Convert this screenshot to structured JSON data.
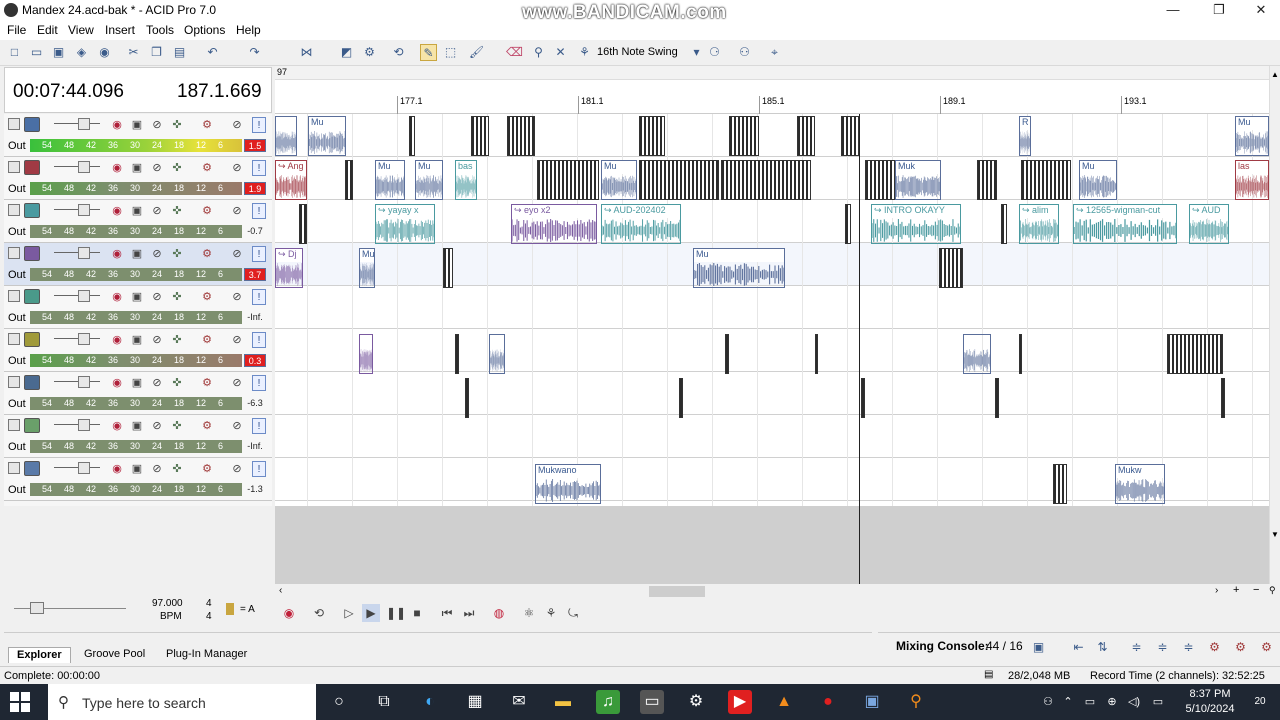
{
  "window": {
    "title": "Mandex 24.acd-bak * - ACID Pro 7.0",
    "watermark": "www.BANDICAM.com",
    "min": "—",
    "max": "❐",
    "close": "✕"
  },
  "menu": [
    "File",
    "Edit",
    "View",
    "Insert",
    "Tools",
    "Options",
    "Help"
  ],
  "toolbar": {
    "swing": "16th Note Swing"
  },
  "transport_display": {
    "time": "00:07:44.096",
    "beat": "187.1.669"
  },
  "meter_ticks": [
    "54",
    "48",
    "42",
    "36",
    "30",
    "24",
    "18",
    "12",
    "6"
  ],
  "tracks": [
    {
      "color": "#4a6fa5",
      "out": "Out",
      "level": "1.5",
      "clip": true,
      "selected": false
    },
    {
      "color": "#a03a44",
      "out": "Out",
      "level": "1.9",
      "clip": true,
      "selected": false
    },
    {
      "color": "#4a9aa0",
      "out": "Out",
      "level": "-0.7",
      "clip": false,
      "selected": false
    },
    {
      "color": "#7a5aa0",
      "out": "Out",
      "level": "3.7",
      "clip": true,
      "selected": true
    },
    {
      "color": "#4a9a8a",
      "out": "Out",
      "level": "-Inf.",
      "clip": false,
      "selected": false
    },
    {
      "color": "#a09a3a",
      "out": "Out",
      "level": "0.3",
      "clip": true,
      "selected": false
    },
    {
      "color": "#4a6a90",
      "out": "Out",
      "level": "-6.3",
      "clip": false,
      "selected": false
    },
    {
      "color": "#6aa06a",
      "out": "Out",
      "level": "-Inf.",
      "clip": false,
      "selected": false
    },
    {
      "color": "#5a7aa8",
      "out": "Out",
      "level": "-1.3",
      "clip": false,
      "selected": false
    }
  ],
  "ruler": {
    "marker": "97",
    "measures": [
      "177.1",
      "181.1",
      "185.1",
      "189.1",
      "193.1"
    ]
  },
  "clips": {
    "ang": "↪ Ang",
    "bas": "bas",
    "yayay": "↪ yayay x",
    "eyo": "↪ eyo x2",
    "aud1": "↪ AUD-202402",
    "intro": "↪ INTRO OKAYY",
    "alim": "↪ alim",
    "wigman": "↪ 12565-wigman-cut",
    "aud2": "↪ AUD",
    "dj": "↪ Dj",
    "mukwano": "Mukwano",
    "mukw": "Mukw",
    "muk": "Muk",
    "mu": "Mu",
    "r": "R",
    "las": "las"
  },
  "tempo": {
    "bpm": "97.000",
    "bpm_label": "BPM",
    "sig_top": "4",
    "sig_bottom": "4",
    "key": "= A"
  },
  "dock": {
    "tabs": [
      "Explorer",
      "Groove Pool",
      "Plug-In Manager"
    ],
    "mixing_label": "Mixing Console:",
    "mixing_count": "44 / 16"
  },
  "status": {
    "text": "Complete: 00:00:00",
    "memory": "28/2,048 MB",
    "record_time": "Record Time (2 channels): 32:52:25"
  },
  "taskbar": {
    "search": "Type here to search",
    "time": "8:37 PM",
    "date": "5/10/2024",
    "notifications": "20"
  }
}
